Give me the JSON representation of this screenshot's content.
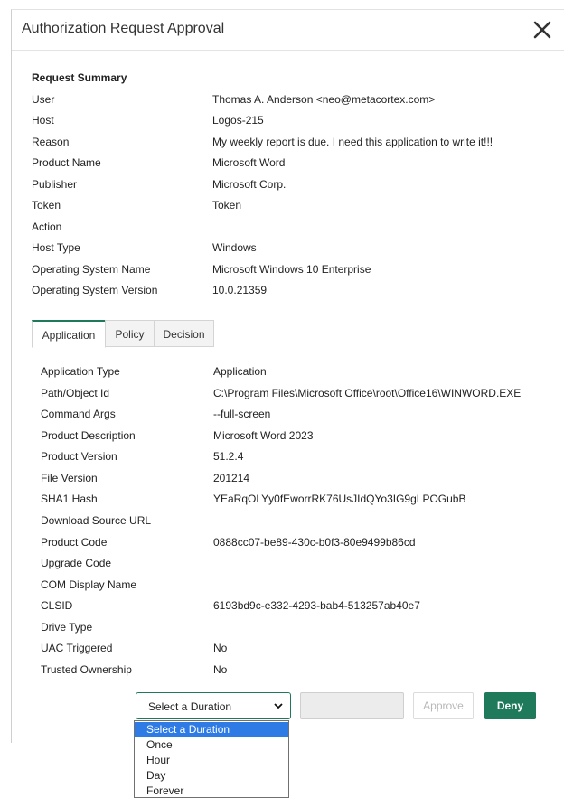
{
  "dialog": {
    "title": "Authorization Request Approval",
    "close_icon": "close-x-icon"
  },
  "summary": {
    "title": "Request Summary",
    "rows": [
      {
        "key": "User",
        "value": "Thomas A. Anderson <neo@metacortex.com>"
      },
      {
        "key": "Host",
        "value": "Logos-215"
      },
      {
        "key": "Reason",
        "value": "My weekly report is due. I need this application to write it!!!"
      },
      {
        "key": "Product Name",
        "value": "Microsoft Word"
      },
      {
        "key": "Publisher",
        "value": "Microsoft Corp."
      },
      {
        "key": "Token",
        "value": "Token"
      },
      {
        "key": "Action",
        "value": ""
      },
      {
        "key": "Host Type",
        "value": "Windows"
      },
      {
        "key": "Operating System Name",
        "value": "Microsoft Windows 10 Enterprise"
      },
      {
        "key": "Operating System Version",
        "value": "10.0.21359"
      }
    ]
  },
  "tabs": [
    {
      "label": "Application",
      "active": true
    },
    {
      "label": "Policy",
      "active": false
    },
    {
      "label": "Decision",
      "active": false
    }
  ],
  "application": {
    "rows": [
      {
        "key": "Application Type",
        "value": "Application"
      },
      {
        "key": "Path/Object Id",
        "value": "C:\\Program Files\\Microsoft Office\\root\\Office16\\WINWORD.EXE"
      },
      {
        "key": "Command Args",
        "value": "--full-screen"
      },
      {
        "key": "Product Description",
        "value": "Microsoft Word 2023"
      },
      {
        "key": "Product Version",
        "value": "51.2.4"
      },
      {
        "key": "File Version",
        "value": "201214"
      },
      {
        "key": "SHA1 Hash",
        "value": "YEaRqOLYy0fEworrRK76UsJIdQYo3IG9gLPOGubB"
      },
      {
        "key": "Download Source URL",
        "value": ""
      },
      {
        "key": "Product Code",
        "value": "0888cc07-be89-430c-b0f3-80e9499b86cd"
      },
      {
        "key": "Upgrade Code",
        "value": ""
      },
      {
        "key": "COM Display Name",
        "value": ""
      },
      {
        "key": "CLSID",
        "value": "6193bd9c-e332-4293-bab4-513257ab40e7"
      },
      {
        "key": "Drive Type",
        "value": ""
      },
      {
        "key": "UAC Triggered",
        "value": "No"
      },
      {
        "key": "Trusted Ownership",
        "value": "No"
      }
    ]
  },
  "footer": {
    "duration_selected": "Select a Duration",
    "duration_options": [
      "Select a Duration",
      "Once",
      "Hour",
      "Day",
      "Forever"
    ],
    "text_value": "",
    "approve_label": "Approve",
    "deny_label": "Deny"
  },
  "colors": {
    "accent": "#1f7a5c",
    "selected_option": "#2f7be5",
    "disabled_text": "#b8b8b8"
  }
}
